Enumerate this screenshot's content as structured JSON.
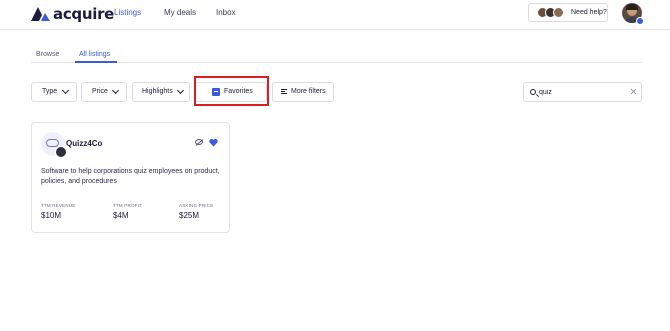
{
  "app": {
    "brand": "acquire"
  },
  "nav": {
    "items": [
      "Listings",
      "My deals",
      "Inbox"
    ]
  },
  "header": {
    "help_label": "Need help?"
  },
  "tabs": [
    "Browse",
    "All listings"
  ],
  "filters": {
    "type": "Type",
    "price": "Price",
    "highlights": "Highlights",
    "favorites": "Favorites",
    "more": "More filters"
  },
  "search": {
    "value": "quiz"
  },
  "listing": {
    "title": "Quizz4Co",
    "description": "Software to help corporations quiz employees on product, policies, and procedures",
    "metrics": [
      {
        "label": "TTM REVENUE",
        "value": "$10M"
      },
      {
        "label": "TTM PROFIT",
        "value": "$4M"
      },
      {
        "label": "ASKING PRICE",
        "value": "$25M"
      }
    ],
    "favorited": true
  },
  "colors": {
    "accent": "#3b5bdb",
    "highlight": "#d71f26",
    "text": "#1c1d3f"
  },
  "icons": [
    "acquire-logo-icon",
    "chevron-down-icon",
    "checkbox-checked-icon",
    "sliders-icon",
    "search-icon",
    "close-icon",
    "eye-off-icon",
    "heart-icon"
  ]
}
